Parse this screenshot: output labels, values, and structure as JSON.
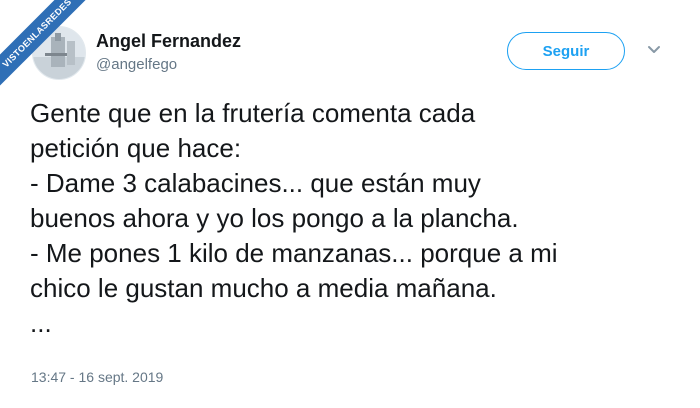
{
  "watermark": {
    "text": "VISTOENLASREDES"
  },
  "author": {
    "name": "Angel Fernandez",
    "handle": "@angelfego"
  },
  "actions": {
    "follow_label": "Seguir",
    "menu_icon": "chevron-down-icon"
  },
  "tweet": {
    "lines": [
      "Gente que en la frutería comenta cada",
      "petición que hace:",
      "- Dame 3 calabacines... que están muy",
      "buenos ahora y yo los pongo a la plancha.",
      "- Me pones 1 kilo de manzanas... porque a mi",
      "chico le gustan mucho a media mañana.",
      "..."
    ],
    "timestamp": "13:47 - 16 sept. 2019"
  },
  "colors": {
    "accent": "#1da1f2",
    "text": "#14171a",
    "muted": "#657786",
    "watermark": "#2f6fb6"
  }
}
